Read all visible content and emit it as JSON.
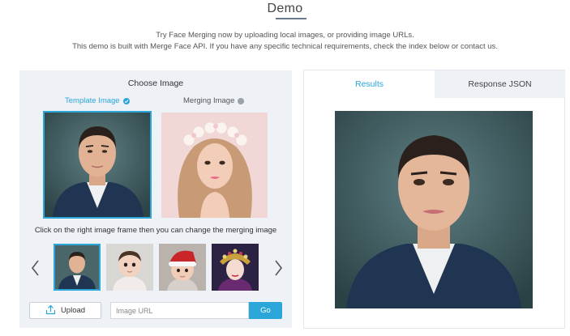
{
  "header": {
    "title": "Demo",
    "subtitle_line1": "Try Face Merging now by uploading local images, or providing image URLs.",
    "subtitle_line2": "This demo is built with Merge Face API. If you have any specific technical requirements, check the index below or contact us."
  },
  "choose_panel": {
    "title": "Choose Image",
    "tab_template": "Template Image",
    "tab_merging": "Merging Image",
    "hint": "Click on the right image frame then you can change the merging image",
    "thumbnails": [
      {
        "icon": "man-portrait-thumbnail",
        "selected": true
      },
      {
        "icon": "baby-thumbnail",
        "selected": false
      },
      {
        "icon": "santa-hat-child-thumbnail",
        "selected": false
      },
      {
        "icon": "opera-headdress-thumbnail",
        "selected": false
      }
    ],
    "upload_label": "Upload",
    "url_placeholder": "Image URL",
    "url_value": "",
    "go_label": "Go"
  },
  "results_panel": {
    "tab_results": "Results",
    "tab_json": "Response JSON"
  },
  "colors": {
    "accent": "#2aa6d8",
    "panel_bg": "#eef1f6",
    "border": "#e3e6eb"
  }
}
